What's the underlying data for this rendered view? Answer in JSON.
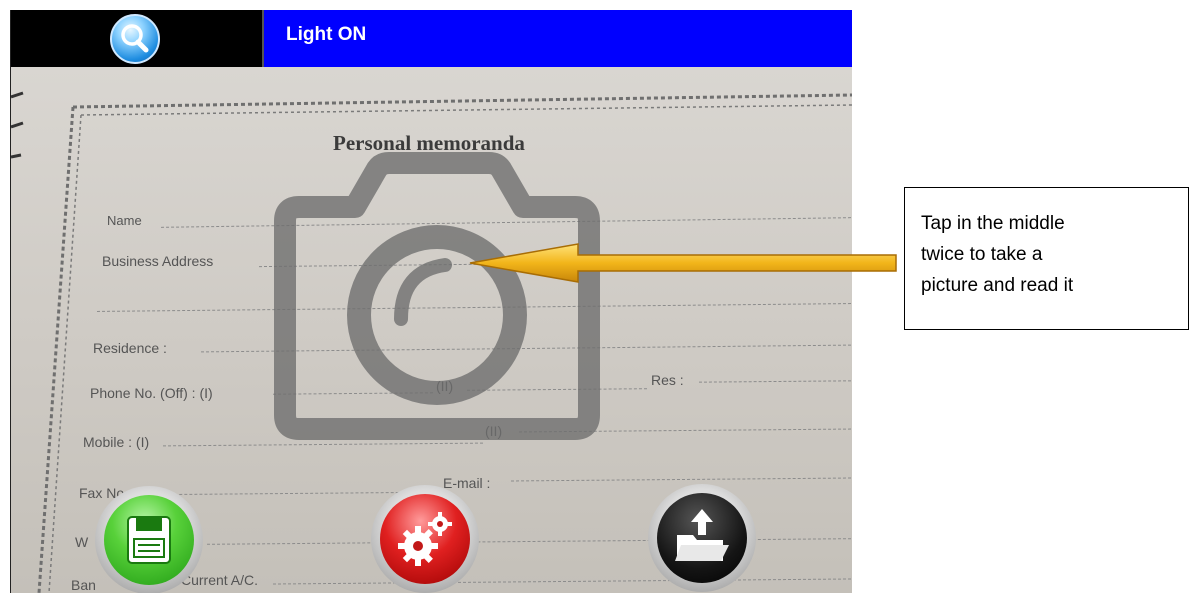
{
  "topbar": {
    "search_icon": "magnifier-icon",
    "light_status": "Light ON",
    "colors": {
      "search_bg": "#000000",
      "light_bg": "#0000ff",
      "light_text": "#ffffff"
    }
  },
  "document": {
    "title": "Personal memoranda",
    "fields": {
      "name": "Name",
      "business_address": "Business Address",
      "residence": "Residence :",
      "phone_off": "Phone No. (Off) : (I)",
      "phone_ii": "(II)",
      "res": "Res :",
      "mobile": "Mobile : (I)",
      "mobile_ii": "(II)",
      "fax": "Fax No.",
      "email": "E-mail :",
      "w": "W",
      "bank": "Ban",
      "current_ac": "Current A/C."
    }
  },
  "overlay": {
    "camera_icon": "camera-icon"
  },
  "toolbar": {
    "save_icon": "floppy-disk-icon",
    "settings_icon": "gears-icon",
    "open_icon": "folder-upload-icon"
  },
  "callout": {
    "lines": [
      "Tap in the middle",
      "twice to take a",
      "picture and read it"
    ]
  }
}
